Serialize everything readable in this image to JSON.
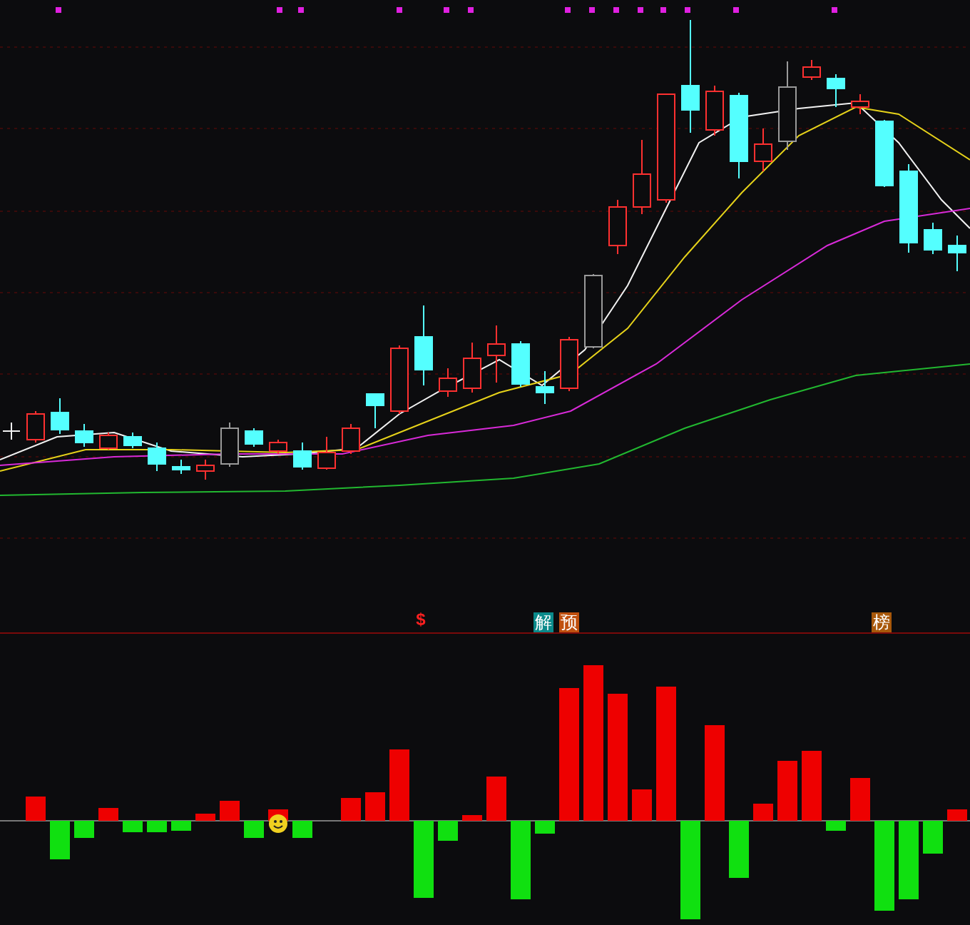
{
  "signal_labels": [
    {
      "text": "$",
      "kind": "plain",
      "color": "#ff2020"
    },
    {
      "text": "解",
      "kind": "tag",
      "color": "#0a8a8a"
    },
    {
      "text": "预",
      "kind": "tag",
      "color": "#c0500f"
    },
    {
      "text": "榜",
      "kind": "tag",
      "color": "#a8580a"
    }
  ]
}
